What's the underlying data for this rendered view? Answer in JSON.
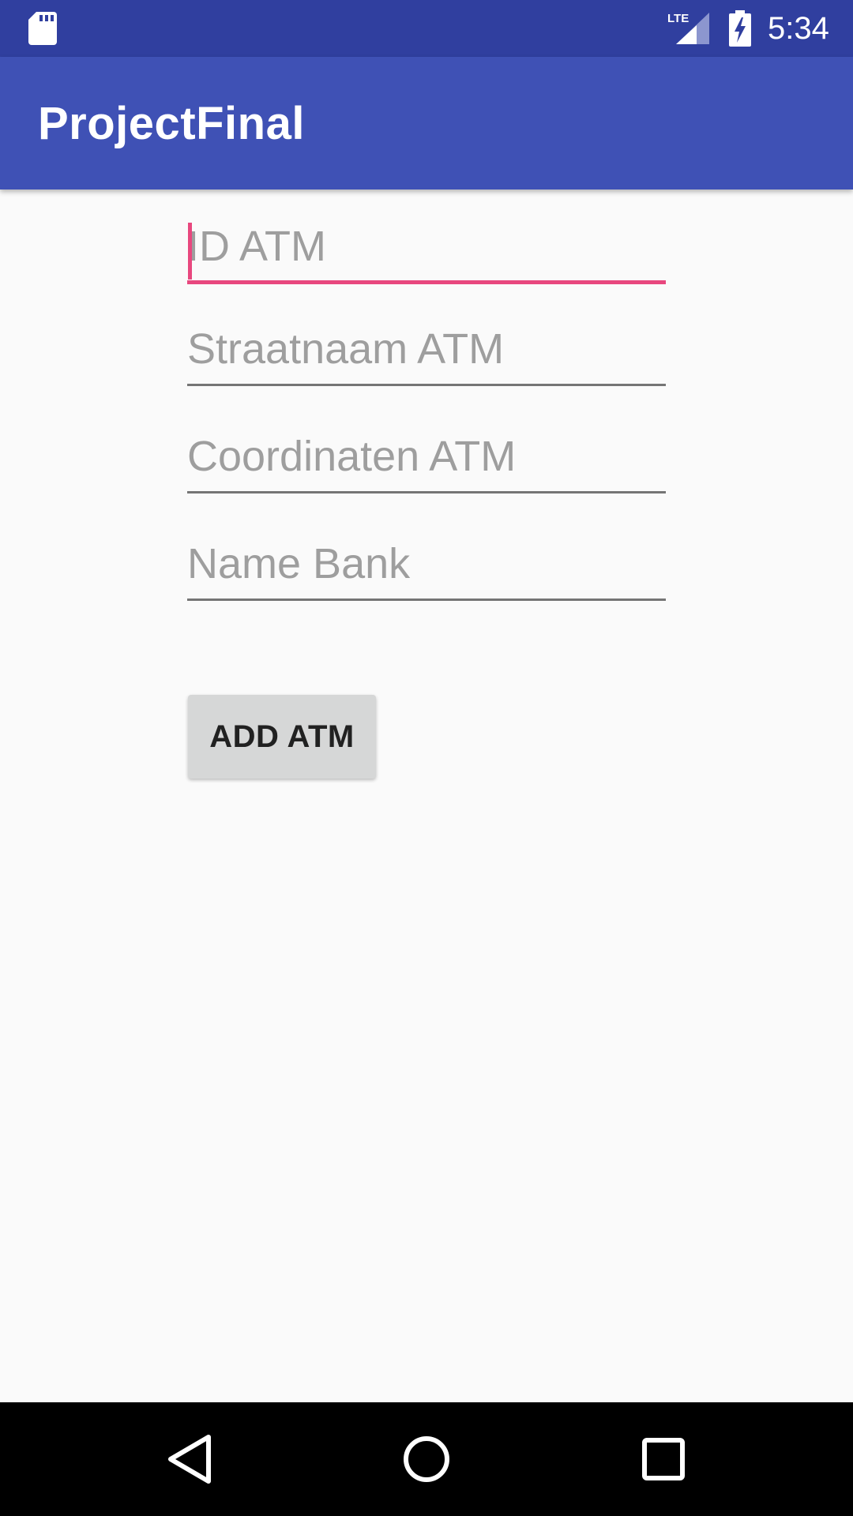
{
  "status_bar": {
    "time": "5:34",
    "network_label": "LTE",
    "icons": [
      "sd-card-icon",
      "lte-signal-icon",
      "battery-charging-icon"
    ]
  },
  "app_bar": {
    "title": "ProjectFinal"
  },
  "form": {
    "id_atm": {
      "placeholder": "ID ATM",
      "value": ""
    },
    "straatnaam_atm": {
      "placeholder": "Straatnaam ATM",
      "value": ""
    },
    "coordinaten_atm": {
      "placeholder": "Coordinaten ATM",
      "value": ""
    },
    "name_bank": {
      "placeholder": "Name Bank",
      "value": ""
    },
    "add_button_label": "ADD ATM"
  },
  "nav_bar": {
    "icons": [
      "back-icon",
      "home-icon",
      "recents-icon"
    ]
  },
  "colors": {
    "status_bar": "#303F9F",
    "app_bar": "#3F51B5",
    "accent": "#E8477E",
    "background": "#FAFAFA",
    "button": "#D6D7D7"
  }
}
